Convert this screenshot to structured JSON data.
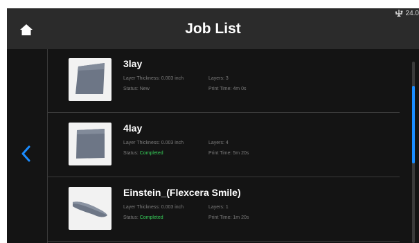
{
  "status_bar": {
    "icon": "usb-icon",
    "value": "24.0"
  },
  "header": {
    "title": "Job List",
    "home_icon": "home-icon"
  },
  "nav": {
    "back_icon": "chevron-left-icon",
    "accent_color": "#1a8cff"
  },
  "labels": {
    "layer_thickness": "Layer Thickness:",
    "layers": "Layers:",
    "status": "Status:",
    "print_time": "Print Time:"
  },
  "jobs": [
    {
      "name": "3lay",
      "layer_thickness": "0.003 inch",
      "layers": "3",
      "status": "New",
      "print_time": "4m 0s",
      "thumbnail": "square-model"
    },
    {
      "name": "4lay",
      "layer_thickness": "0.003 inch",
      "layers": "4",
      "status": "Completed",
      "print_time": "5m 20s",
      "thumbnail": "square-model"
    },
    {
      "name": "Einstein_(Flexcera Smile)",
      "layer_thickness": "0.003 inch",
      "layers": "1",
      "status": "Completed",
      "print_time": "1m 20s",
      "thumbnail": "dental-arch-model"
    }
  ],
  "colors": {
    "completed": "#37d15a",
    "new": "#7d7d7d",
    "scroll_thumb": "#1a8cff"
  }
}
